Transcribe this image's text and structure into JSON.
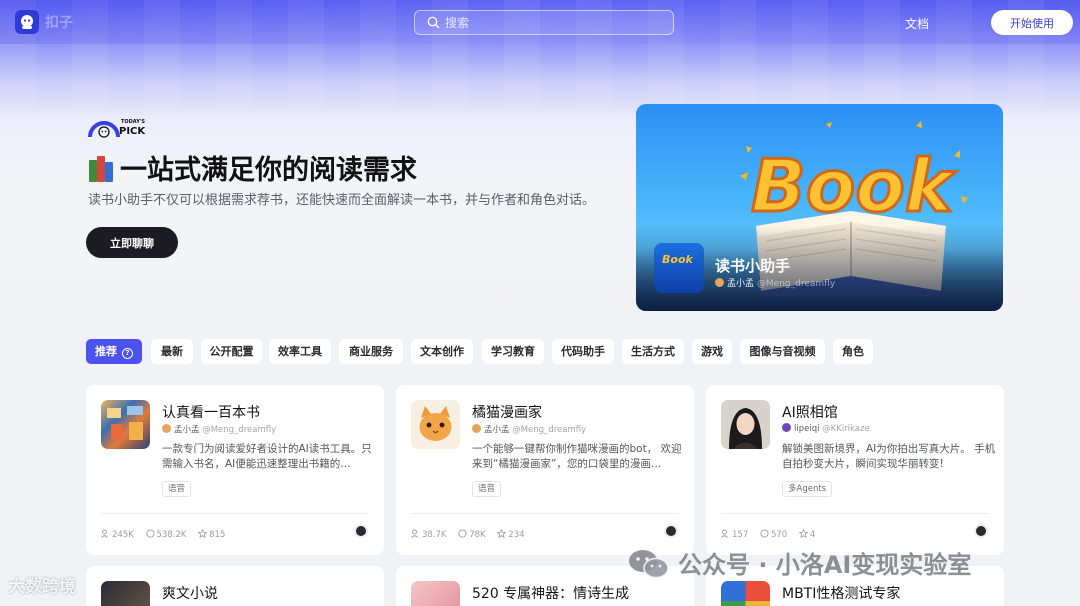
{
  "header": {
    "brand": "扣子",
    "search_placeholder": "搜索",
    "docs_label": "文档",
    "start_label": "开始使用"
  },
  "hero": {
    "badge_top": "TODAY'S",
    "badge_main": "PICK",
    "title": "一站式满足你的阅读需求",
    "subtitle": "读书小助手不仅可以根据需求荐书，还能快速而全面解读一本书，并与作者和角色对话。",
    "cta_label": "立即聊聊"
  },
  "banner": {
    "icon_text": "Book",
    "title": "读书小助手",
    "author": "孟小孟",
    "handle": "@Meng_dreamfly"
  },
  "tabs": [
    {
      "label": "推荐",
      "active": true
    },
    {
      "label": "最新"
    },
    {
      "label": "公开配置"
    },
    {
      "label": "效率工具"
    },
    {
      "label": "商业服务"
    },
    {
      "label": "文本创作"
    },
    {
      "label": "学习教育"
    },
    {
      "label": "代码助手"
    },
    {
      "label": "生活方式"
    },
    {
      "label": "游戏"
    },
    {
      "label": "图像与音视频"
    },
    {
      "label": "角色"
    }
  ],
  "cards": [
    {
      "title": "认真看一百本书",
      "author": "孟小孟",
      "handle": "@Meng_dreamfly",
      "desc": "一款专门为阅读爱好者设计的AI读书工具。只需输入书名，AI便能迅速整理出书籍的…",
      "tag": "语音",
      "users": "245K",
      "chats": "538.2K",
      "stars": "815"
    },
    {
      "title": "橘猫漫画家",
      "author": "孟小孟",
      "handle": "@Meng_dreamfly",
      "desc": "一个能够一键帮你制作猫咪漫画的bot， 欢迎来到“橘猫漫画家”，您的口袋里的漫画…",
      "tag": "语音",
      "users": "38.7K",
      "chats": "78K",
      "stars": "234"
    },
    {
      "title": "AI照相馆",
      "author": "lipeiqi",
      "handle": "@KKirikaze",
      "desc": "解锁美图新境界，AI为你拍出写真大片。 手机自拍秒变大片，瞬间实现华丽转变!",
      "tag": "多Agents",
      "users": "157",
      "chats": "570",
      "stars": "4"
    }
  ],
  "cards_row2": [
    {
      "title": "爽文小说"
    },
    {
      "title": "520 专属神器：情诗生成"
    },
    {
      "title": "MBTI性格测试专家"
    }
  ],
  "watermarks": {
    "right": "公众号 · 小洛AI变现实验室",
    "left": "大数跨境"
  },
  "colors": {
    "accent": "#4c52ee",
    "dark_button": "#1b1b21"
  }
}
